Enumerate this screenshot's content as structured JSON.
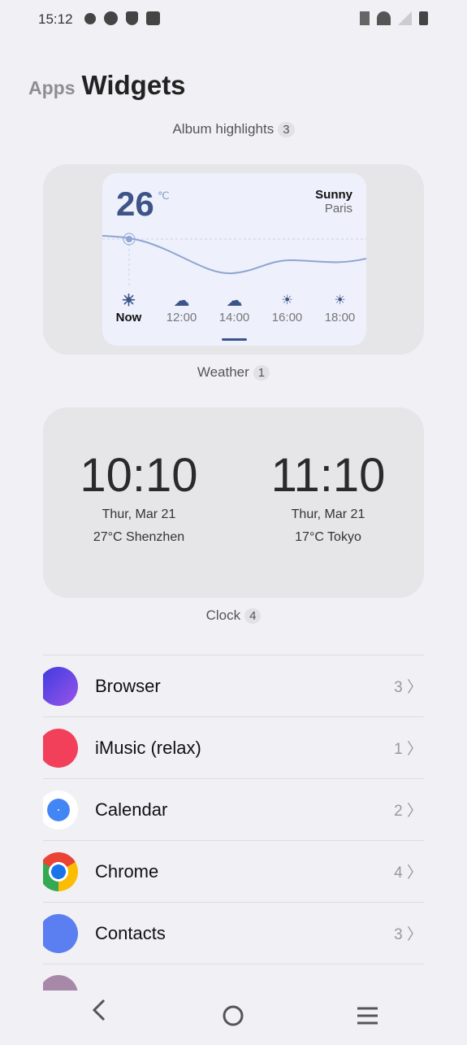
{
  "status_bar": {
    "time": "15:12",
    "icons": [
      "gear-icon",
      "speedometer-icon",
      "shield-check-icon",
      "bag-icon",
      "vibrate-icon",
      "wifi-icon",
      "signal-icon",
      "battery-icon"
    ]
  },
  "header": {
    "tab_apps": "Apps",
    "tab_widgets": "Widgets"
  },
  "groups": {
    "album": {
      "label": "Album highlights",
      "count": "3"
    },
    "weather": {
      "label": "Weather",
      "count": "1",
      "temp": "26",
      "unit": "℃",
      "condition": "Sunny",
      "city": "Paris",
      "hours": [
        {
          "time": "Now",
          "icon": "sun-icon"
        },
        {
          "time": "12:00",
          "icon": "cloud-icon"
        },
        {
          "time": "14:00",
          "icon": "cloud-icon"
        },
        {
          "time": "16:00",
          "icon": "sun-icon"
        },
        {
          "time": "18:00",
          "icon": "sun-icon"
        }
      ]
    },
    "clock": {
      "label": "Clock",
      "count": "4",
      "clocks": [
        {
          "time": "10:10",
          "date": "Thur,  Mar 21",
          "weather": "27°C  Shenzhen"
        },
        {
          "time": "11:10",
          "date": "Thur,  Mar 21",
          "weather": "17°C  Tokyo"
        }
      ]
    }
  },
  "apps": [
    {
      "name": "Browser",
      "count": "3",
      "color": "#5b3fd8"
    },
    {
      "name": "iMusic (relax)",
      "count": "1",
      "color": "#f2405a"
    },
    {
      "name": "Calendar",
      "count": "2",
      "color": "#ffffff"
    },
    {
      "name": "Chrome",
      "count": "4",
      "color": "#db4437"
    },
    {
      "name": "Contacts",
      "count": "3",
      "color": "#5b7ef0"
    }
  ],
  "colors": {
    "accent": "#3d5488",
    "background": "#f1f0f5",
    "card": "#e6e6e9"
  }
}
